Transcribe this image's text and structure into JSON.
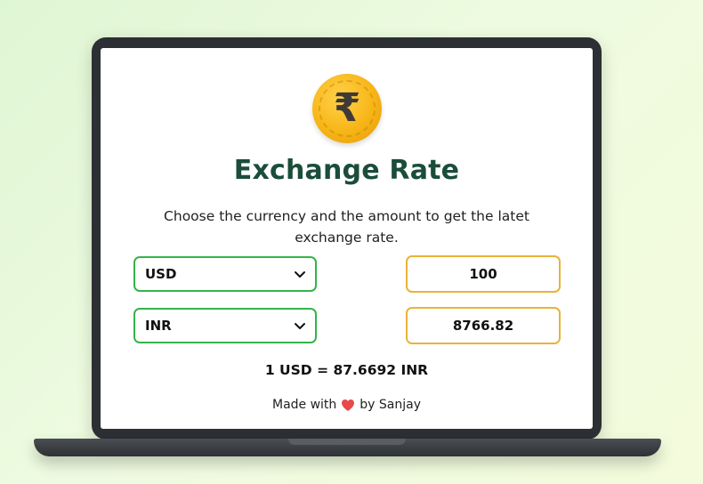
{
  "app": {
    "logo_glyph": "₹",
    "title": "Exchange Rate",
    "description": "Choose the currency and the amount to get the latet exchange rate."
  },
  "converter": {
    "from_currency": "USD",
    "to_currency": "INR",
    "amount": "100",
    "converted_amount": "8766.82",
    "rate_text": "1 USD = 87.6692 INR"
  },
  "footer": {
    "prefix": "Made with",
    "suffix": "by Sanjay"
  },
  "icons": {
    "logo": "rupee-coin-icon",
    "dropdown": "chevron-down-icon",
    "heart": "heart-icon"
  },
  "colors": {
    "title": "#1a4d3a",
    "select_border": "#34b44a",
    "amount_border": "#e9b23b",
    "coin": "#f7b516",
    "heart": "#e84a4a"
  }
}
